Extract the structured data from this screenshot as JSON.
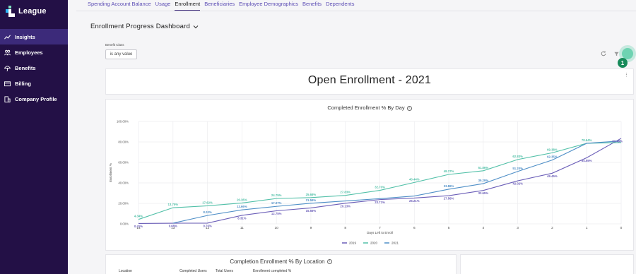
{
  "sidebar": {
    "logo": "League",
    "items": [
      {
        "label": "Insights",
        "icon": "trend-icon",
        "active": true
      },
      {
        "label": "Employees",
        "icon": "people-icon",
        "active": false
      },
      {
        "label": "Benefits",
        "icon": "umbrella-icon",
        "active": false
      },
      {
        "label": "Billing",
        "icon": "card-icon",
        "active": false
      },
      {
        "label": "Company Profile",
        "icon": "building-icon",
        "active": false
      }
    ]
  },
  "tabs": [
    "Spending Account Balance",
    "Usage",
    "Enrollment",
    "Beneficiaries",
    "Employee Demographics",
    "Benefits",
    "Dependents"
  ],
  "active_tab": "Enrollment",
  "dashboard": {
    "title": "Enrollment Progress Dashboard",
    "filter_label": "Benefit Class",
    "filter_value": "is any value",
    "step_badge": "1"
  },
  "title_card": {
    "text": "Open Enrollment - 2021"
  },
  "chart_data": {
    "type": "line",
    "title": "Completed Enrollment % By Day",
    "xlabel": "Days Left to Enroll",
    "ylabel": "Enrollment %",
    "categories": [
      "14",
      "13",
      "12",
      "11",
      "10",
      "9",
      "8",
      "7",
      "6",
      "5",
      "4",
      "3",
      "2",
      "1",
      "0"
    ],
    "ylim": [
      0,
      100
    ],
    "y_ticks": [
      "0.00%",
      "20.00%",
      "40.00%",
      "60.00%",
      "80.00%",
      "100.00%"
    ],
    "grid": true,
    "legend_position": "bottom",
    "series": [
      {
        "name": "2019",
        "color": "#6b5eb8",
        "values": [
          0.41,
          0.68,
          0.76,
          8.31,
          12.75,
          15.56,
          20.13,
          23.71,
          25.21,
          27.56,
          32.65,
          42.02,
          49.45,
          64.55,
          83.49
        ],
        "labels": [
          "0.41%",
          "0.68%",
          "0.76%",
          "8.31%",
          "12.75%",
          "15.56%",
          "20.13%",
          "23.71%",
          "25.21%",
          "27.56%",
          "32.65%",
          "42.02%",
          "49.45%",
          "64.55%",
          "83.49%"
        ]
      },
      {
        "name": "2020",
        "color": "#52c0a8",
        "values": [
          4.34,
          15.75,
          17.62,
          20.36,
          24.75,
          25.68,
          27.83,
          32.7,
          40.44,
          48.27,
          51.86,
          62.83,
          69.38,
          78.64,
          79.46
        ],
        "labels": [
          "4.34%",
          "13.75%",
          "17.62%",
          "20.36%",
          "24.75%",
          "25.68%",
          "27.83%",
          "32.70%",
          "40.44%",
          "48.27%",
          "51.86%",
          "62.83%",
          "69.38%",
          "78.64%",
          ""
        ]
      },
      {
        "name": "2021",
        "color": "#4f8fc7",
        "values": [
          null,
          0.68,
          8.2,
          13.66,
          17.07,
          20.1,
          22.4,
          24.6,
          27.21,
          33.86,
          39.29,
          51.2,
          62.35,
          78.64,
          81.0
        ],
        "labels": [
          "",
          "",
          "8.20%",
          "13.66%",
          "17.07%",
          "21.59%",
          "",
          "",
          "",
          "33.86%",
          "39.29%",
          "51.20%",
          "62.35%",
          "",
          ""
        ]
      }
    ]
  },
  "location_card": {
    "title": "Completion Enrollment % By Location",
    "columns": [
      "Location",
      "Completed Users",
      "Total Users",
      "Enrollment completed %"
    ]
  }
}
